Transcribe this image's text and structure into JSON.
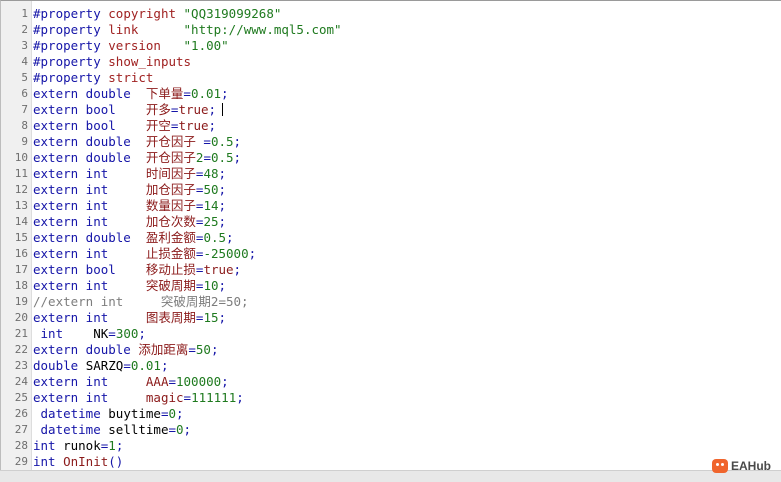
{
  "colors": {
    "keyword": "#1515a8",
    "property_name": "#a02222",
    "string": "#1f7a1f",
    "number": "#1f7a1f",
    "identifier": "#8b1a1a",
    "comment": "#7d7d7d",
    "gutter_background": "#f0f0f0"
  },
  "editor": {
    "lines": [
      {
        "no": "1",
        "tokens": [
          {
            "t": "#property ",
            "c": "kw"
          },
          {
            "t": "copyright ",
            "c": "pn"
          },
          {
            "t": "\"QQ319099268\"",
            "c": "st"
          }
        ]
      },
      {
        "no": "2",
        "tokens": [
          {
            "t": "#property ",
            "c": "kw"
          },
          {
            "t": "link      ",
            "c": "pn"
          },
          {
            "t": "\"http://www.mql5.com\"",
            "c": "st"
          }
        ]
      },
      {
        "no": "3",
        "tokens": [
          {
            "t": "#property ",
            "c": "kw"
          },
          {
            "t": "version   ",
            "c": "pn"
          },
          {
            "t": "\"1.00\"",
            "c": "st"
          }
        ]
      },
      {
        "no": "4",
        "tokens": [
          {
            "t": "#property ",
            "c": "kw"
          },
          {
            "t": "show_inputs",
            "c": "pn"
          }
        ]
      },
      {
        "no": "5",
        "tokens": [
          {
            "t": "#property ",
            "c": "kw"
          },
          {
            "t": "strict",
            "c": "pn"
          }
        ]
      },
      {
        "no": "6",
        "tokens": [
          {
            "t": "extern double  ",
            "c": "tp"
          },
          {
            "t": "下单量",
            "c": "id"
          },
          {
            "t": "=",
            "c": "op"
          },
          {
            "t": "0.01",
            "c": "nm"
          },
          {
            "t": ";",
            "c": "op"
          }
        ]
      },
      {
        "no": "7",
        "tokens": [
          {
            "t": "extern bool    ",
            "c": "tp"
          },
          {
            "t": "开多",
            "c": "id"
          },
          {
            "t": "=",
            "c": "op"
          },
          {
            "t": "true",
            "c": "id"
          },
          {
            "t": ";",
            "c": "op"
          }
        ],
        "caret": true
      },
      {
        "no": "8",
        "tokens": [
          {
            "t": "extern bool    ",
            "c": "tp"
          },
          {
            "t": "开空",
            "c": "id"
          },
          {
            "t": "=",
            "c": "op"
          },
          {
            "t": "true",
            "c": "id"
          },
          {
            "t": ";",
            "c": "op"
          }
        ]
      },
      {
        "no": "9",
        "tokens": [
          {
            "t": "extern double  ",
            "c": "tp"
          },
          {
            "t": "开仓因子 ",
            "c": "id"
          },
          {
            "t": "=",
            "c": "op"
          },
          {
            "t": "0.5",
            "c": "nm"
          },
          {
            "t": ";",
            "c": "op"
          }
        ]
      },
      {
        "no": "10",
        "tokens": [
          {
            "t": "extern double  ",
            "c": "tp"
          },
          {
            "t": "开仓因子",
            "c": "id"
          },
          {
            "t": "2",
            "c": "nm"
          },
          {
            "t": "=",
            "c": "op"
          },
          {
            "t": "0.5",
            "c": "nm"
          },
          {
            "t": ";",
            "c": "op"
          }
        ]
      },
      {
        "no": "11",
        "tokens": [
          {
            "t": "extern int     ",
            "c": "tp"
          },
          {
            "t": "时间因子",
            "c": "id"
          },
          {
            "t": "=",
            "c": "op"
          },
          {
            "t": "48",
            "c": "nm"
          },
          {
            "t": ";",
            "c": "op"
          }
        ]
      },
      {
        "no": "12",
        "tokens": [
          {
            "t": "extern int     ",
            "c": "tp"
          },
          {
            "t": "加仓因子",
            "c": "id"
          },
          {
            "t": "=",
            "c": "op"
          },
          {
            "t": "50",
            "c": "nm"
          },
          {
            "t": ";",
            "c": "op"
          }
        ]
      },
      {
        "no": "13",
        "tokens": [
          {
            "t": "extern int     ",
            "c": "tp"
          },
          {
            "t": "数量因子",
            "c": "id"
          },
          {
            "t": "=",
            "c": "op"
          },
          {
            "t": "14",
            "c": "nm"
          },
          {
            "t": ";",
            "c": "op"
          }
        ]
      },
      {
        "no": "14",
        "tokens": [
          {
            "t": "extern int     ",
            "c": "tp"
          },
          {
            "t": "加仓次数",
            "c": "id"
          },
          {
            "t": "=",
            "c": "op"
          },
          {
            "t": "25",
            "c": "nm"
          },
          {
            "t": ";",
            "c": "op"
          }
        ]
      },
      {
        "no": "15",
        "tokens": [
          {
            "t": "extern double  ",
            "c": "tp"
          },
          {
            "t": "盈利金额",
            "c": "id"
          },
          {
            "t": "=",
            "c": "op"
          },
          {
            "t": "0.5",
            "c": "nm"
          },
          {
            "t": ";",
            "c": "op"
          }
        ]
      },
      {
        "no": "16",
        "tokens": [
          {
            "t": "extern int     ",
            "c": "tp"
          },
          {
            "t": "止损金额",
            "c": "id"
          },
          {
            "t": "=",
            "c": "op"
          },
          {
            "t": "-25000",
            "c": "nm"
          },
          {
            "t": ";",
            "c": "op"
          }
        ]
      },
      {
        "no": "17",
        "tokens": [
          {
            "t": "extern bool    ",
            "c": "tp"
          },
          {
            "t": "移动止损",
            "c": "id"
          },
          {
            "t": "=",
            "c": "op"
          },
          {
            "t": "true",
            "c": "id"
          },
          {
            "t": ";",
            "c": "op"
          }
        ]
      },
      {
        "no": "18",
        "tokens": [
          {
            "t": "extern int     ",
            "c": "tp"
          },
          {
            "t": "突破周期",
            "c": "id"
          },
          {
            "t": "=",
            "c": "op"
          },
          {
            "t": "10",
            "c": "nm"
          },
          {
            "t": ";",
            "c": "op"
          }
        ]
      },
      {
        "no": "19",
        "tokens": [
          {
            "t": "//extern int     突破周期2=50;",
            "c": "cm"
          }
        ]
      },
      {
        "no": "20",
        "tokens": [
          {
            "t": "extern int     ",
            "c": "tp"
          },
          {
            "t": "图表周期",
            "c": "id"
          },
          {
            "t": "=",
            "c": "op"
          },
          {
            "t": "15",
            "c": "nm"
          },
          {
            "t": ";",
            "c": "op"
          }
        ]
      },
      {
        "no": "21",
        "tokens": [
          {
            "t": " int    ",
            "c": "tp"
          },
          {
            "t": "NK",
            "c": "pl"
          },
          {
            "t": "=",
            "c": "op"
          },
          {
            "t": "300",
            "c": "nm"
          },
          {
            "t": ";",
            "c": "op"
          }
        ]
      },
      {
        "no": "22",
        "tokens": [
          {
            "t": "extern double ",
            "c": "tp"
          },
          {
            "t": "添加距离",
            "c": "id"
          },
          {
            "t": "=",
            "c": "op"
          },
          {
            "t": "50",
            "c": "nm"
          },
          {
            "t": ";",
            "c": "op"
          }
        ]
      },
      {
        "no": "23",
        "tokens": [
          {
            "t": "double ",
            "c": "tp"
          },
          {
            "t": "SARZQ",
            "c": "pl"
          },
          {
            "t": "=",
            "c": "op"
          },
          {
            "t": "0.01",
            "c": "nm"
          },
          {
            "t": ";",
            "c": "op"
          }
        ]
      },
      {
        "no": "24",
        "tokens": [
          {
            "t": "extern int     ",
            "c": "tp"
          },
          {
            "t": "AAA",
            "c": "id"
          },
          {
            "t": "=",
            "c": "op"
          },
          {
            "t": "100000",
            "c": "nm"
          },
          {
            "t": ";",
            "c": "op"
          }
        ]
      },
      {
        "no": "25",
        "tokens": [
          {
            "t": "extern int     ",
            "c": "tp"
          },
          {
            "t": "magic",
            "c": "id"
          },
          {
            "t": "=",
            "c": "op"
          },
          {
            "t": "111111",
            "c": "nm"
          },
          {
            "t": ";",
            "c": "op"
          }
        ]
      },
      {
        "no": "26",
        "tokens": [
          {
            "t": " datetime ",
            "c": "tp"
          },
          {
            "t": "buytime",
            "c": "pl"
          },
          {
            "t": "=",
            "c": "op"
          },
          {
            "t": "0",
            "c": "nm"
          },
          {
            "t": ";",
            "c": "op"
          }
        ]
      },
      {
        "no": "27",
        "tokens": [
          {
            "t": " datetime ",
            "c": "tp"
          },
          {
            "t": "selltime",
            "c": "pl"
          },
          {
            "t": "=",
            "c": "op"
          },
          {
            "t": "0",
            "c": "nm"
          },
          {
            "t": ";",
            "c": "op"
          }
        ]
      },
      {
        "no": "28",
        "tokens": [
          {
            "t": "int ",
            "c": "tp"
          },
          {
            "t": "runok",
            "c": "pl"
          },
          {
            "t": "=",
            "c": "op"
          },
          {
            "t": "1",
            "c": "nm"
          },
          {
            "t": ";",
            "c": "op"
          }
        ]
      },
      {
        "no": "29",
        "tokens": [
          {
            "t": "int ",
            "c": "tp"
          },
          {
            "t": "OnInit",
            "c": "id"
          },
          {
            "t": "()",
            "c": "op"
          }
        ]
      }
    ]
  },
  "watermark": {
    "icon": "eahub-logo-icon",
    "text": "EAHub"
  }
}
